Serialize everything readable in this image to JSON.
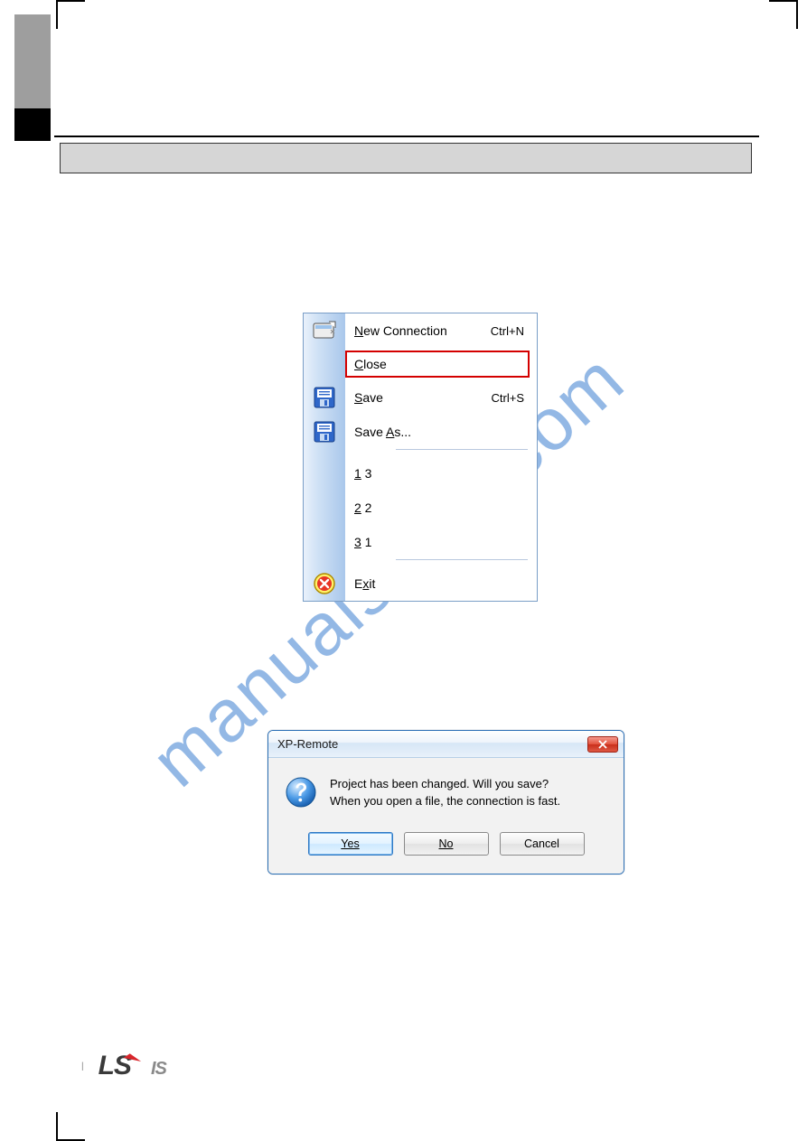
{
  "watermark": "manualshive.com",
  "menu": {
    "new_connection": {
      "label_pre": "N",
      "label_rest": "ew Connection",
      "shortcut": "Ctrl+N"
    },
    "close": {
      "label_pre": "C",
      "label_rest": "lose"
    },
    "save": {
      "label_pre": "S",
      "label_rest": "ave",
      "shortcut": "Ctrl+S"
    },
    "save_as": {
      "label_pre": "Save ",
      "label_u": "A",
      "label_post": "s..."
    },
    "recent": [
      {
        "num_u": "1",
        "rest": " 3"
      },
      {
        "num_u": "2",
        "rest": " 2"
      },
      {
        "num_u": "3",
        "rest": " 1"
      }
    ],
    "exit": {
      "label_pre": "E",
      "label_u": "x",
      "label_post": "it"
    }
  },
  "dialog": {
    "title": "XP-Remote",
    "line1": "Project has been changed. Will you save?",
    "line2": "When you open a file, the connection is fast.",
    "yes": "Yes",
    "no": "No",
    "cancel": "Cancel",
    "close_x": "x"
  },
  "logo": {
    "ls": "LS",
    "is": "IS"
  }
}
